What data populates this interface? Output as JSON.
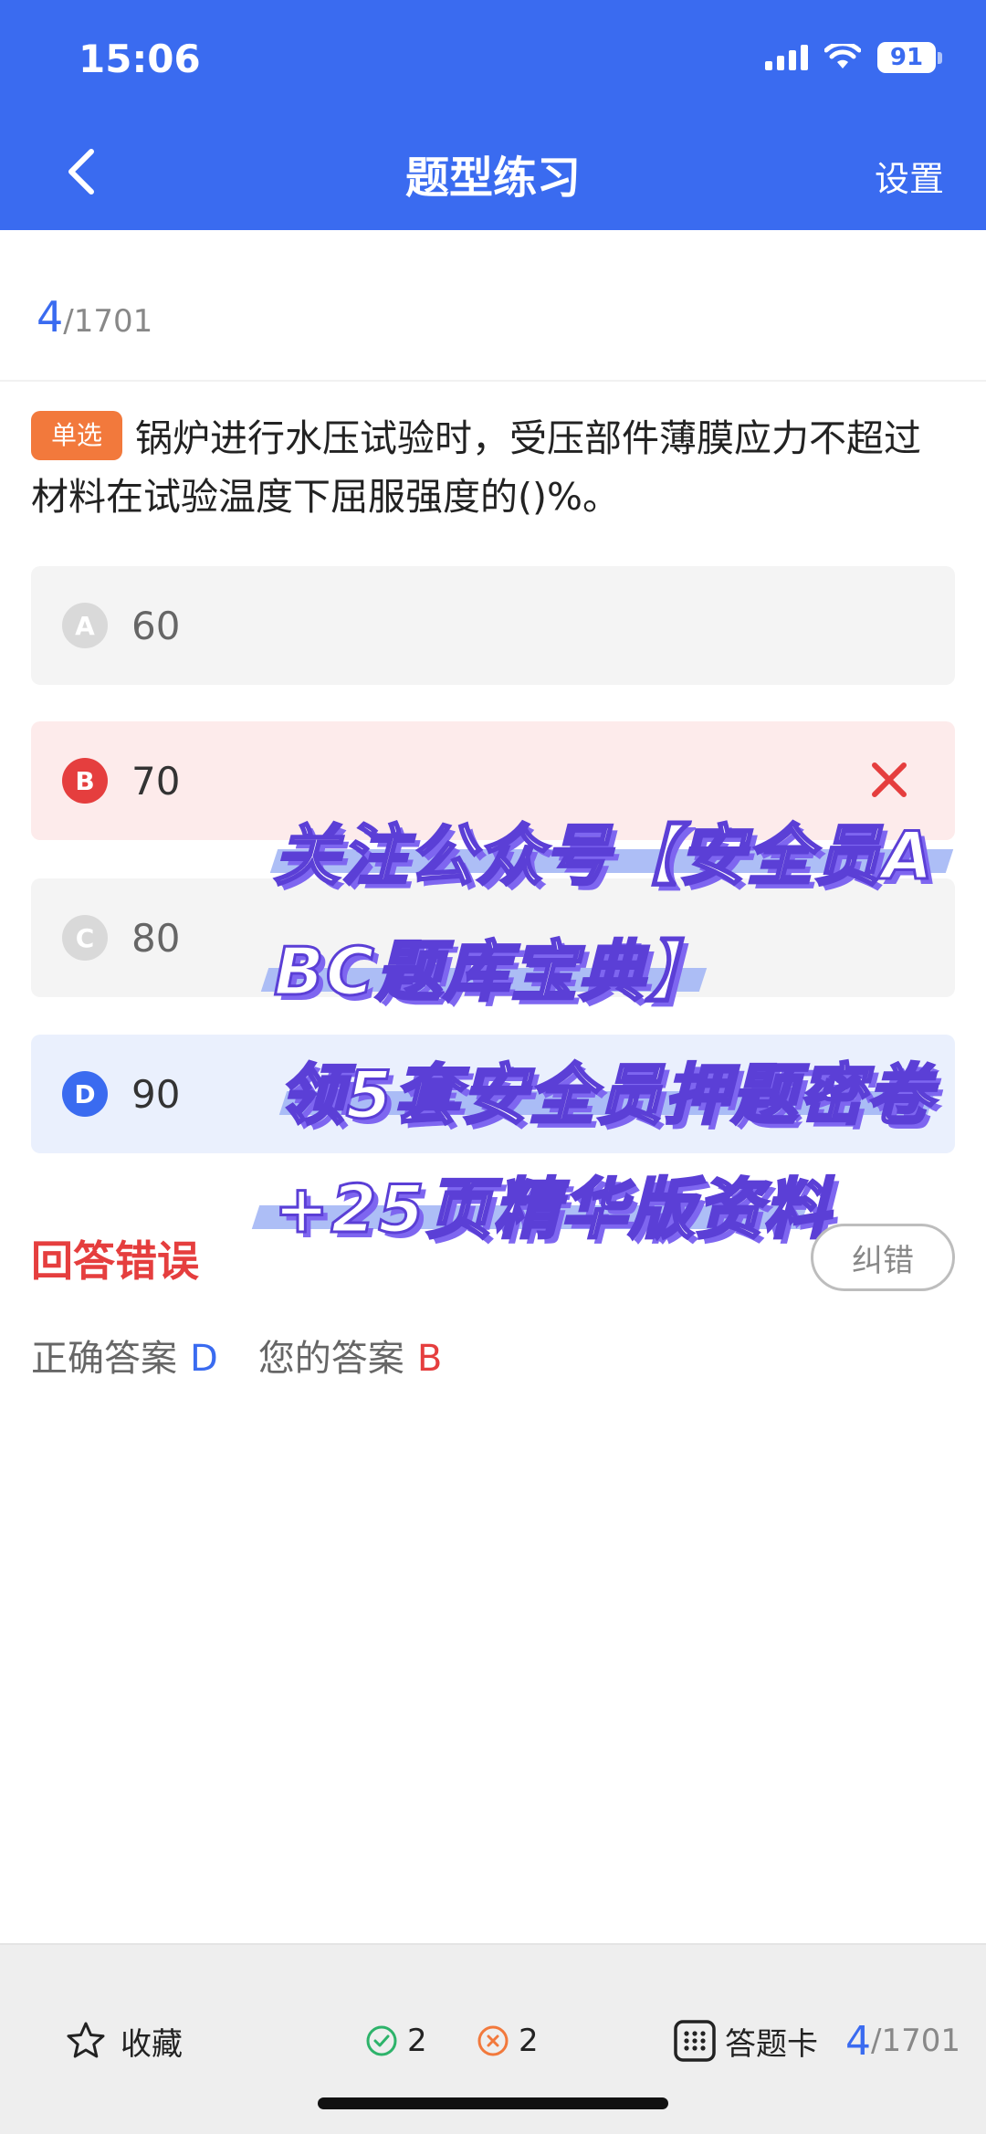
{
  "status_bar": {
    "time": "15:06",
    "battery": "91"
  },
  "nav": {
    "title": "题型练习",
    "settings": "设置"
  },
  "progress": {
    "current": "4",
    "total": "/1701"
  },
  "question": {
    "type_tag": "单选",
    "text": "锅炉进行水压试验时，受压部件薄膜应力不超过材料在试验温度下屈服强度的()%。"
  },
  "options": [
    {
      "letter": "A",
      "text": "60",
      "state": "normal"
    },
    {
      "letter": "B",
      "text": "70",
      "state": "wrong"
    },
    {
      "letter": "C",
      "text": "80",
      "state": "normal"
    },
    {
      "letter": "D",
      "text": "90",
      "state": "correct"
    }
  ],
  "promo": {
    "line1": "关注公众号【安全员A",
    "line2": "BC题库宝典】",
    "line3": "领5套安全员押题密卷",
    "line4": "+25页精华版资料"
  },
  "result": {
    "status": "回答错误",
    "report_button": "纠错",
    "correct_label": "正确答案",
    "correct_value": "D",
    "mine_label": "您的答案",
    "mine_value": "B"
  },
  "bottom_bar": {
    "favorite": "收藏",
    "right_count": "2",
    "wrong_count": "2",
    "answer_card": "答题卡",
    "progress_current": "4",
    "progress_total": "/1701"
  },
  "colors": {
    "primary": "#3A6BF0",
    "error": "#E53E3E",
    "tag": "#F2793C"
  },
  "icons": [
    "back-arrow-icon",
    "signal-icon",
    "wifi-icon",
    "battery-icon",
    "close-icon",
    "star-icon",
    "check-circle-icon",
    "cross-circle-icon",
    "grid-icon"
  ]
}
